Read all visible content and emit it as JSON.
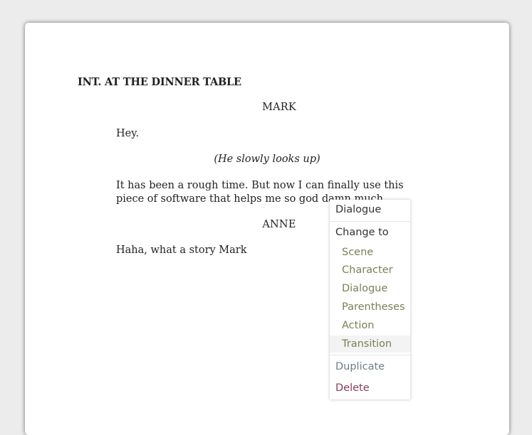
{
  "script": {
    "scene_heading": "INT. AT THE DINNER TABLE",
    "character_1": "MARK",
    "dialogue_1": "Hey.",
    "parenthetical_1": "(He slowly looks up)",
    "dialogue_2": "It has been a rough time. But now I can finally use this piece of software that helps me so god damn much.",
    "character_2": "ANNE",
    "dialogue_3": "Haha, what a story Mark"
  },
  "context_menu": {
    "current_type": "Dialogue",
    "change_to_label": "Change to",
    "options": [
      "Scene",
      "Character",
      "Dialogue",
      "Parentheses",
      "Action",
      "Transition"
    ],
    "hovered_option": "Transition",
    "duplicate_label": "Duplicate",
    "delete_label": "Delete"
  },
  "colors": {
    "page_background": "#ffffff",
    "app_background": "#ececec",
    "option_text": "#7a7f55",
    "duplicate_text": "#6e7f86",
    "delete_text": "#8a3b5b"
  }
}
